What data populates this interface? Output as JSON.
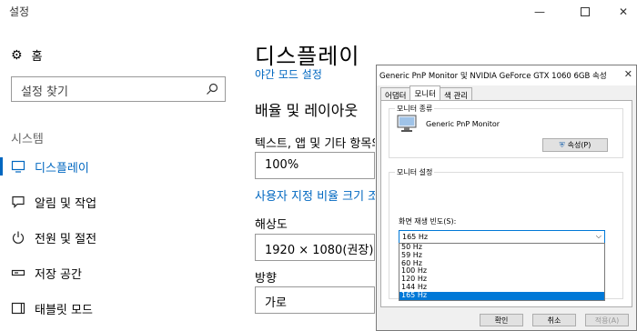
{
  "window": {
    "title": "설정"
  },
  "sidebar": {
    "home": "홈",
    "search_placeholder": "설정 찾기",
    "section": "시스템",
    "items": [
      {
        "label": "디스플레이",
        "icon": "monitor-icon"
      },
      {
        "label": "알림 및 작업",
        "icon": "notification-icon"
      },
      {
        "label": "전원 및 절전",
        "icon": "power-icon"
      },
      {
        "label": "저장 공간",
        "icon": "storage-icon"
      },
      {
        "label": "태블릿 모드",
        "icon": "tablet-icon"
      }
    ]
  },
  "main": {
    "title": "디스플레이",
    "night_light_link": "야간 모드 설정",
    "layout_heading": "배율 및 레이아웃",
    "scale_label": "텍스트, 앱 및 기타 항목의 크기 변경",
    "scale_value": "100%",
    "custom_scale_link": "사용자 지정 비율 크기 조정",
    "resolution_label": "해상도",
    "resolution_value": "1920 × 1080(권장)",
    "orientation_label": "방향",
    "orientation_value": "가로"
  },
  "dialog": {
    "title": "Generic PnP Monitor 및 NVIDIA GeForce GTX 1060 6GB 속성",
    "tabs": [
      "어댑터",
      "모니터",
      "색 관리"
    ],
    "selected_tab": "모니터",
    "monitor_type_group": "모니터 종류",
    "monitor_name": "Generic PnP Monitor",
    "properties_button": "속성(P)",
    "settings_group": "모니터 설정",
    "refresh_label": "화면 재생 빈도(S):",
    "refresh_selected": "165 Hz",
    "refresh_options": [
      "50 Hz",
      "59 Hz",
      "60 Hz",
      "100 Hz",
      "120 Hz",
      "144 Hz",
      "165 Hz"
    ],
    "ok": "확인",
    "cancel": "취소",
    "apply": "적용(A)"
  },
  "colors": {
    "accent": "#0067c0",
    "selection": "#0078d7"
  }
}
